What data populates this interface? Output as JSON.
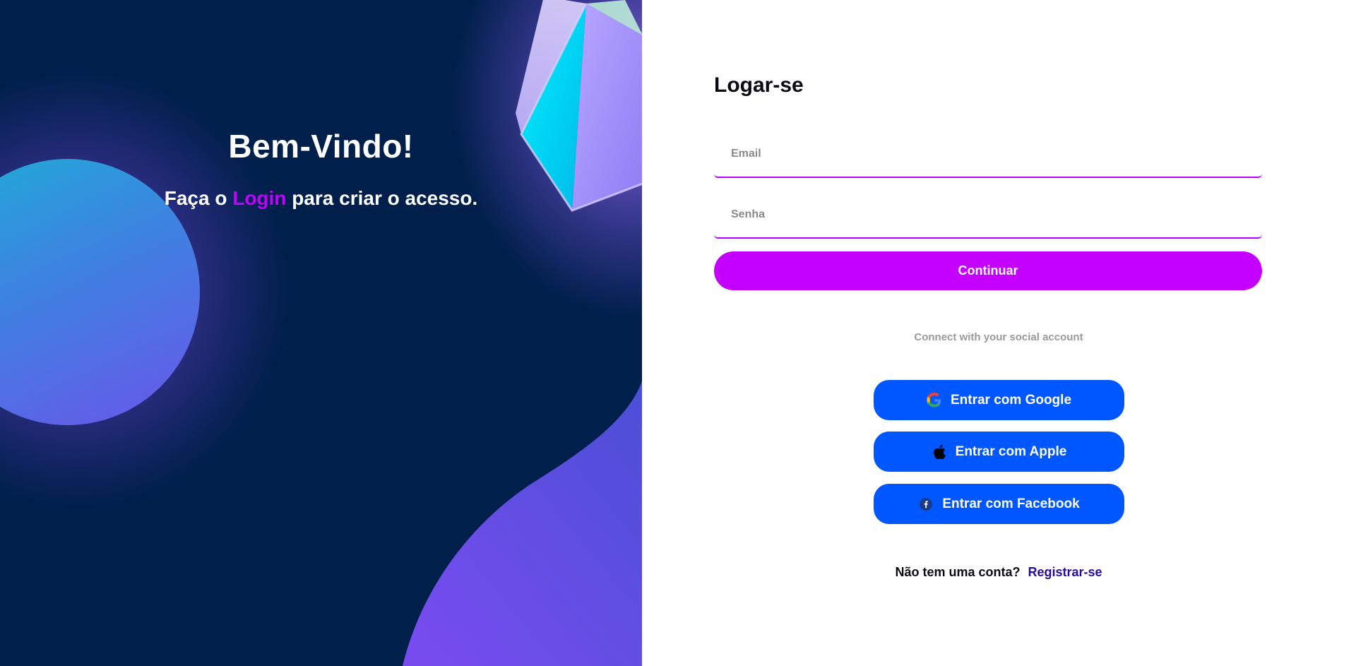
{
  "hero": {
    "title": "Bem-Vindo!",
    "subtitle_before": "Faça o ",
    "subtitle_accent": "Login",
    "subtitle_after": " para criar o acesso."
  },
  "form": {
    "title": "Logar-se",
    "email_placeholder": "Email",
    "password_placeholder": "Senha",
    "continue_label": "Continuar"
  },
  "social": {
    "caption": "Connect with your social account",
    "google_label": "Entrar com Google",
    "apple_label": "Entrar com Apple",
    "facebook_label": "Entrar com Facebook"
  },
  "signup": {
    "prompt": "Não tem uma conta?",
    "link_label": "Registrar-se"
  },
  "colors": {
    "hero_bg": "#001f4b",
    "accent": "#c400ff",
    "social_button": "#0057ff",
    "link": "#2a0a9a"
  },
  "icons": [
    "google-icon",
    "apple-icon",
    "facebook-icon"
  ]
}
